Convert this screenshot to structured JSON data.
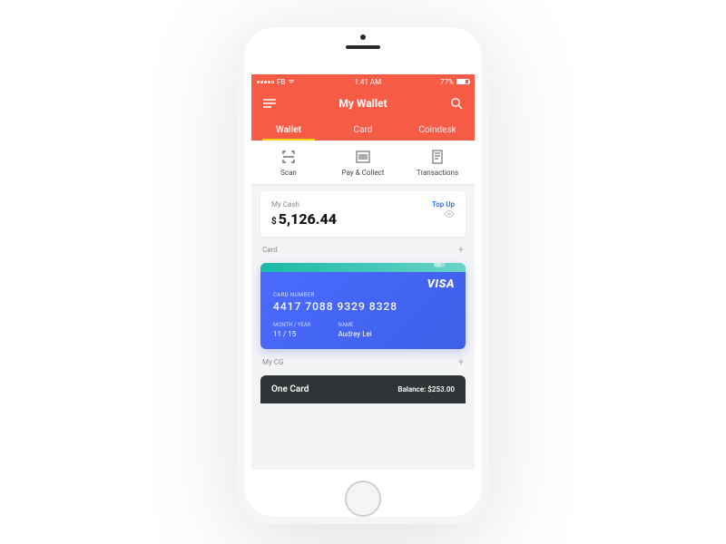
{
  "statusbar": {
    "carrier": "FB",
    "wifi_icon": "wifi",
    "time": "1:41 AM",
    "battery_pct": "77%"
  },
  "header": {
    "title": "My Wallet",
    "tabs": [
      {
        "label": "Wallet",
        "active": true
      },
      {
        "label": "Card",
        "active": false
      },
      {
        "label": "Coindesk",
        "active": false
      }
    ]
  },
  "actions": [
    {
      "label": "Scan",
      "icon": "scan"
    },
    {
      "label": "Pay & Collect",
      "icon": "barcode"
    },
    {
      "label": "Transactions",
      "icon": "receipt"
    }
  ],
  "cash": {
    "label": "My Cash",
    "topup_label": "Top Up",
    "currency": "$",
    "amount": "5,126.44"
  },
  "card_section": {
    "label": "Card",
    "card": {
      "brand": "VISA",
      "number_label": "CARD NUMBER",
      "number": "4417  7088  9329  8328",
      "exp_label": "MONTH / YEAR",
      "exp": "11 / 15",
      "name_label": "NAME",
      "name": "Audrey Lei"
    }
  },
  "cg_section": {
    "label": "My CG",
    "onecard": {
      "title": "One Card",
      "balance_label": "Balance:",
      "balance": "$253.00"
    }
  },
  "colors": {
    "accent": "#f55b45",
    "tab_underline": "#ffd400",
    "link": "#2f6eff",
    "card_gradient_from": "#4a6bff",
    "card_gradient_to": "#3e5fe6",
    "onecard_bg": "#2f3437"
  }
}
